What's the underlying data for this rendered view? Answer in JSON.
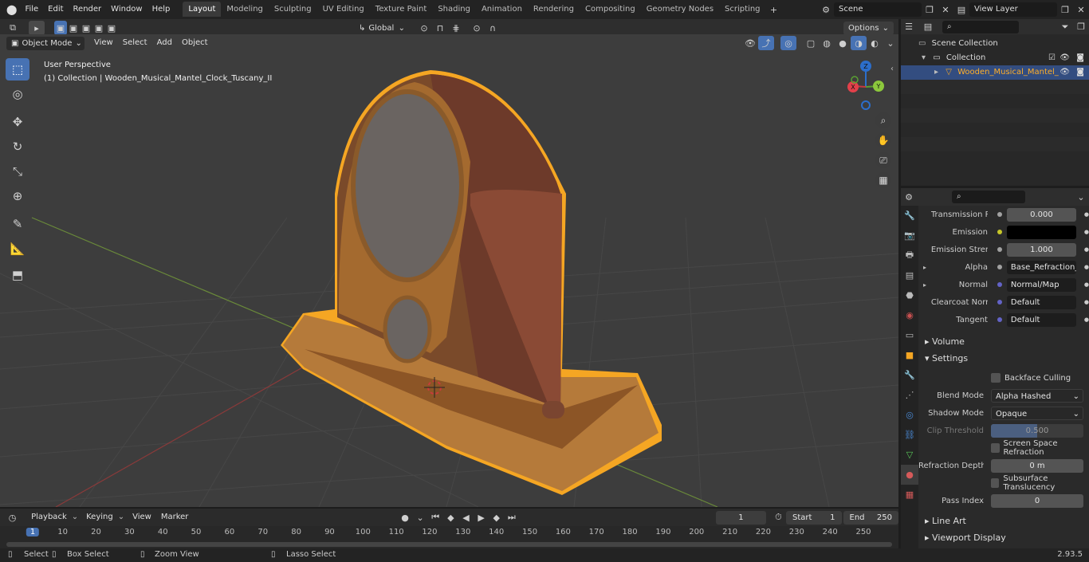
{
  "topbar": {
    "menus": [
      "File",
      "Edit",
      "Render",
      "Window",
      "Help"
    ],
    "workspaces": [
      "Layout",
      "Modeling",
      "Sculpting",
      "UV Editing",
      "Texture Paint",
      "Shading",
      "Animation",
      "Rendering",
      "Compositing",
      "Geometry Nodes",
      "Scripting"
    ],
    "active_workspace": "Layout",
    "scene": "Scene",
    "view_layer": "View Layer"
  },
  "viewport_header": {
    "mode": "Object Mode",
    "menus": [
      "View",
      "Select",
      "Add",
      "Object"
    ],
    "orientation": "Global",
    "options": "Options"
  },
  "viewport": {
    "perspective_label": "User Perspective",
    "collection_label": "(1) Collection | Wooden_Musical_Mantel_Clock_Tuscany_II",
    "gizmo": {
      "x": "X",
      "y": "Y",
      "z": "Z"
    }
  },
  "outliner": {
    "scene_collection": "Scene Collection",
    "collection": "Collection",
    "object": "Wooden_Musical_Mantel_"
  },
  "properties": {
    "rows": [
      {
        "label": "Transmission R...",
        "value": "0.000",
        "kind": "slider",
        "socket": "#a1a1a1"
      },
      {
        "label": "Emission",
        "value": "",
        "kind": "color",
        "socket": "#c7c729"
      },
      {
        "label": "Emission Strengt",
        "value": "1.000",
        "kind": "slider",
        "socket": "#a1a1a1"
      },
      {
        "label": "Alpha",
        "value": "Base_Refraction_inv...",
        "kind": "link",
        "socket": "#a1a1a1",
        "expand": true
      },
      {
        "label": "Normal",
        "value": "Normal/Map",
        "kind": "link",
        "socket": "#6363c7",
        "expand": true
      },
      {
        "label": "Clearcoat Normal",
        "value": "Default",
        "kind": "link",
        "socket": "#6363c7"
      },
      {
        "label": "Tangent",
        "value": "Default",
        "kind": "link",
        "socket": "#6363c7"
      }
    ],
    "volume": "Volume",
    "settings": "Settings",
    "backface_culling": "Backface Culling",
    "blend_mode_label": "Blend Mode",
    "blend_mode": "Alpha Hashed",
    "shadow_mode_label": "Shadow Mode",
    "shadow_mode": "Opaque",
    "clip_threshold_label": "Clip Threshold",
    "clip_threshold": "0.500",
    "ssr": "Screen Space Refraction",
    "refraction_depth_label": "Refraction Depth",
    "refraction_depth": "0 m",
    "subsurface": "Subsurface Translucency",
    "pass_index_label": "Pass Index",
    "pass_index": "0",
    "line_art": "Line Art",
    "viewport_display": "Viewport Display"
  },
  "timeline": {
    "menus": [
      "Playback",
      "Keying",
      "View",
      "Marker"
    ],
    "current_frame": "1",
    "start_label": "Start",
    "start": "1",
    "end_label": "End",
    "end": "250",
    "ruler": [
      "1",
      "10",
      "20",
      "30",
      "40",
      "50",
      "60",
      "70",
      "80",
      "90",
      "100",
      "110",
      "120",
      "130",
      "140",
      "150",
      "160",
      "170",
      "180",
      "190",
      "200",
      "210",
      "220",
      "230",
      "240",
      "250"
    ]
  },
  "statusbar": {
    "select": "Select",
    "box_select": "Box Select",
    "zoom_view": "Zoom View",
    "lasso_select": "Lasso Select",
    "version": "2.93.5"
  },
  "colors": {
    "accent": "#4772b3",
    "selection_outline": "#f5a623",
    "active_workspace": "#3a3a3a",
    "playhead": "#4772b3"
  }
}
